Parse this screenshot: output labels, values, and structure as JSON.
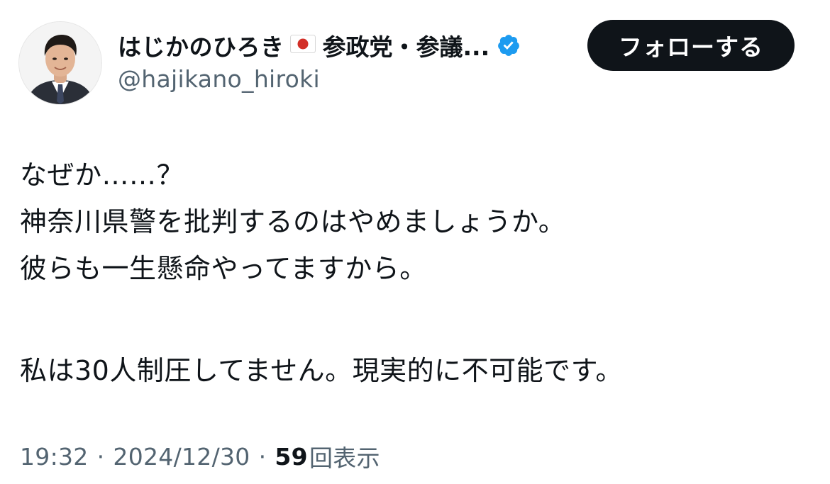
{
  "header": {
    "display_name": "はじかのひろき",
    "flag_icon": "japan-flag-icon",
    "party_affiliation": "参政党・参議...",
    "verified_icon": "verified-badge-icon",
    "verified_color": "#1d9bf0",
    "handle": "@hajikano_hiroki",
    "follow_label": "フォローする"
  },
  "tweet": {
    "lines": [
      "なぜか……？",
      "神奈川県警を批判するのはやめましょうか。",
      "彼らも一生懸命やってますから。",
      "",
      "私は30人制圧してません。現実的に不可能です。"
    ]
  },
  "meta": {
    "time": "19:32",
    "separator": "·",
    "date": "2024/12/30",
    "views_count": "59",
    "views_label": "回表示"
  }
}
